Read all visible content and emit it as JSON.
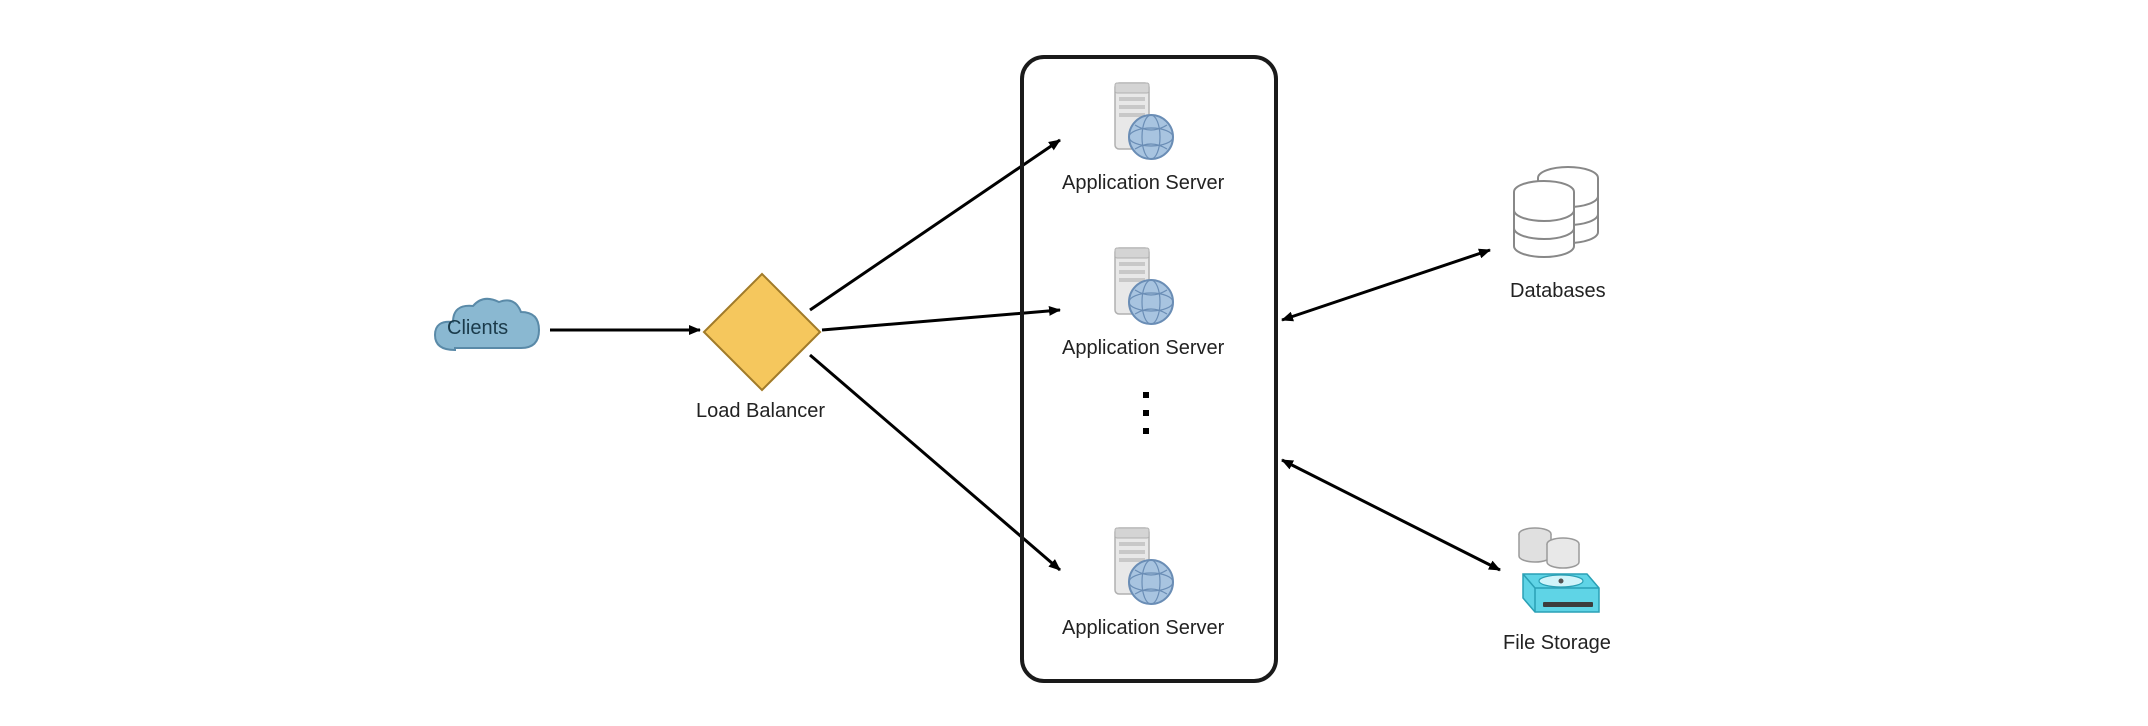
{
  "nodes": {
    "clients": {
      "label": "Clients"
    },
    "load_balancer": {
      "label": "Load Balancer"
    },
    "app_servers": {
      "items": [
        {
          "label": "Application Server"
        },
        {
          "label": "Application Server"
        },
        {
          "label": "Application Server"
        }
      ]
    },
    "databases": {
      "label": "Databases"
    },
    "file_storage": {
      "label": "File Storage"
    }
  },
  "icons": {
    "cloud": "cloud-icon",
    "diamond": "diamond-icon",
    "server": "server-icon",
    "globe": "globe-icon",
    "database": "database-icon",
    "disk": "disk-icon"
  },
  "colors": {
    "cloud_fill": "#8ab8d1",
    "cloud_stroke": "#5a8aa8",
    "diamond_fill": "#f5c75d",
    "diamond_stroke": "#a07a2a",
    "server_fill": "#e8e8e8",
    "server_stroke": "#b0b0b0",
    "globe_fill": "#a8c4e0",
    "globe_stroke": "#6a8db5",
    "arrow": "#000000",
    "box_stroke": "#1a1a1a",
    "storage_cyan": "#5fd4e6",
    "storage_dark": "#535353"
  },
  "arrows": [
    {
      "from": "clients",
      "to": "load_balancer",
      "bidir": false
    },
    {
      "from": "load_balancer",
      "to": "app_server_1",
      "bidir": false
    },
    {
      "from": "load_balancer",
      "to": "app_server_2",
      "bidir": false
    },
    {
      "from": "load_balancer",
      "to": "app_server_3",
      "bidir": false
    },
    {
      "from": "app_server_cluster",
      "to": "databases",
      "bidir": true
    },
    {
      "from": "app_server_cluster",
      "to": "file_storage",
      "bidir": true
    }
  ]
}
